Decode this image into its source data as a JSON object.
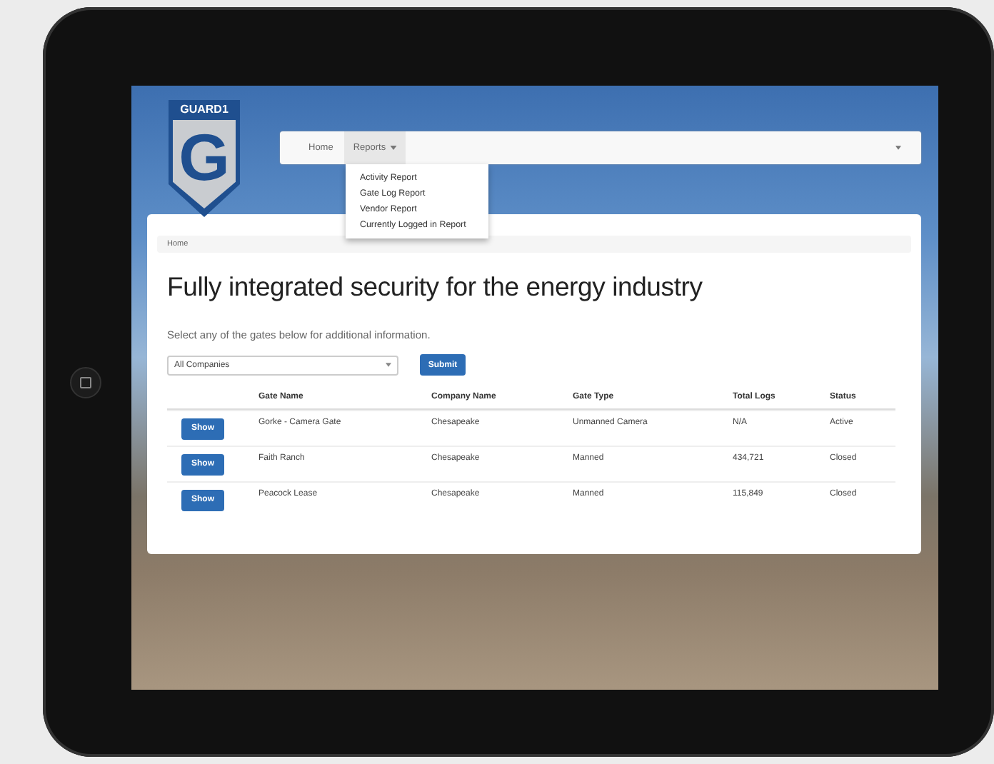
{
  "logo": {
    "wordmark": "GUARD1",
    "letter": "G"
  },
  "nav": {
    "items": [
      {
        "label": "Home",
        "selected": false,
        "has_menu": false
      },
      {
        "label": "Reports",
        "selected": true,
        "has_menu": true
      }
    ],
    "menu": {
      "expanded": true,
      "items": [
        "Activity Report",
        "Gate Log Report",
        "Vendor Report",
        "Currently Logged in Report"
      ]
    }
  },
  "breadcrumb": "Home",
  "heading": "Fully integrated security for the energy industry",
  "intro": "Select any of the gates below for additional information.",
  "filter": {
    "value": "All Companies",
    "button": "Submit"
  },
  "table": {
    "columns": [
      "Gate Name",
      "Company Name",
      "Gate Type",
      "Total Logs",
      "Status"
    ],
    "rows": [
      {
        "action": "Show",
        "cells": [
          "Gorke - Camera Gate",
          "Chesapeake",
          "Unmanned Camera",
          "N/A",
          "Active"
        ]
      },
      {
        "action": "Show",
        "cells": [
          "Faith Ranch",
          "Chesapeake",
          "Manned",
          "434,721",
          "Closed"
        ]
      },
      {
        "action": "Show",
        "cells": [
          "Peacock Lease",
          "Chesapeake",
          "Manned",
          "115,849",
          "Closed"
        ]
      }
    ]
  }
}
